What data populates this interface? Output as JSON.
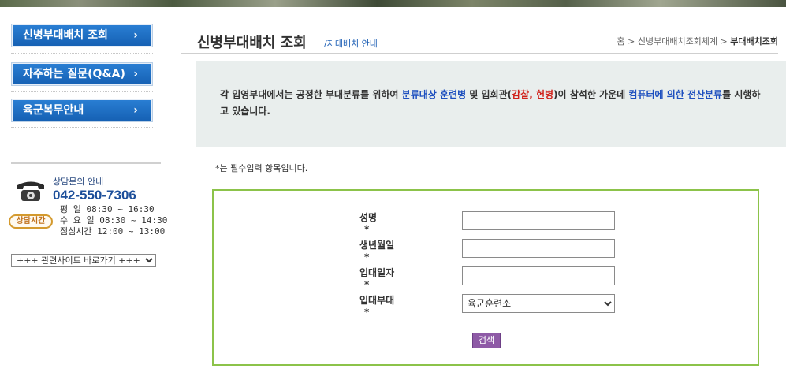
{
  "sidebar": {
    "nav": [
      {
        "label": "신병부대배치 조회",
        "chevron": "›"
      },
      {
        "label": "자주하는 질문(Q&A)",
        "chevron": "›"
      },
      {
        "label": "육군복무안내",
        "chevron": "›"
      }
    ],
    "contact": {
      "title": "상담문의 안내",
      "phone": "042-550-7306",
      "hours_badge": "상담시간",
      "hours": [
        "평   일 08:30 ~ 16:30",
        "수 요 일 08:30 ~ 14:30",
        "점심시간 12:00 ~ 13:00"
      ],
      "icon": "telephone-icon"
    },
    "related_sites": {
      "selected": "+++ 관련사이트 바로가기 +++"
    }
  },
  "header": {
    "title": "신병부대배치 조회",
    "subtitle": "/자대배치 안내",
    "breadcrumb": {
      "home": "홈",
      "sep": ">",
      "parent": "신병부대배치조회체계",
      "current": "부대배치조회"
    }
  },
  "notice": {
    "t1": "각 입영부대에서는 공정한 부대분류를 위하여 ",
    "t2": "분류대상 훈련병",
    "t3": " 및 입회관(",
    "t4": "감찰, 헌병",
    "t5": ")이 참석한 가운데 ",
    "t6": "컴퓨터에 의한 전산분류",
    "t7": "를 시행하고 있습니다."
  },
  "form": {
    "required_note": "*는 필수입력 항목입니다.",
    "fields": [
      {
        "label": "성명",
        "star": "*",
        "value": ""
      },
      {
        "label": "생년월일",
        "star": "*",
        "value": ""
      },
      {
        "label": "입대일자",
        "star": "*",
        "value": ""
      },
      {
        "label": "입대부대",
        "star": "*",
        "selected": "육군훈련소"
      }
    ],
    "search_label": "검색"
  },
  "colors": {
    "nav_blue": "#1f6fc4",
    "form_border": "#8cc34a",
    "search_button": "#8e5aa6",
    "notice_bg": "#e9eeed",
    "highlight_blue": "#1d4fbf",
    "highlight_red": "#d0221b"
  }
}
